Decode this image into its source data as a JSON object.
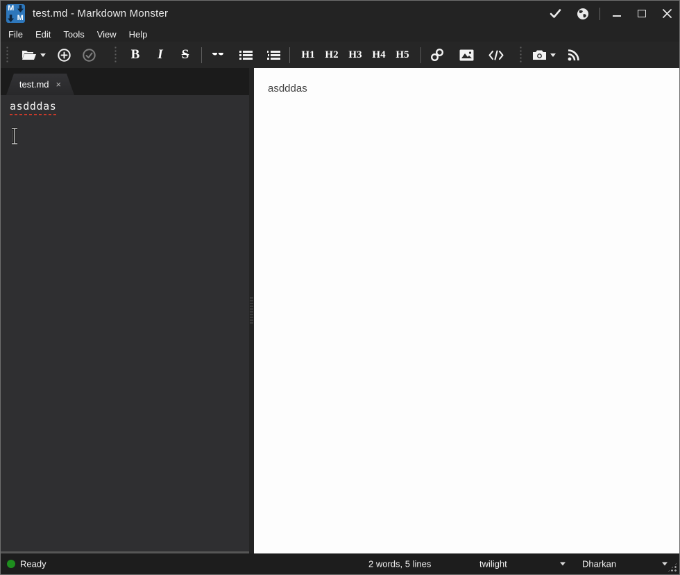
{
  "titlebar": {
    "title": "test.md  - Markdown Monster",
    "logo_top_left": "M",
    "logo_bottom_right": "M"
  },
  "menu": {
    "items": [
      "File",
      "Edit",
      "Tools",
      "View",
      "Help"
    ]
  },
  "toolbar": {
    "bold_label": "B",
    "italic_label": "I",
    "strike_label": "S",
    "headings": [
      "H1",
      "H2",
      "H3",
      "H4",
      "H5"
    ],
    "quote_glyph": "“"
  },
  "tabbar": {
    "active_tab_label": "test.md",
    "tab_close_glyph": "×"
  },
  "editor": {
    "text": "asdddas"
  },
  "preview": {
    "text": "asdddas"
  },
  "statusbar": {
    "status": "Ready",
    "counts": "2 words, 5 lines",
    "preview_theme": "twilight",
    "editor_theme": "Dharkan"
  },
  "colors": {
    "logo_blue": "#2e77bb",
    "status_green": "#1e8e1e",
    "spellcheck_red": "#c83a2a",
    "titlebar_bg": "#232323",
    "editor_bg": "#2f2f31",
    "preview_bg": "#fdfdfd"
  }
}
